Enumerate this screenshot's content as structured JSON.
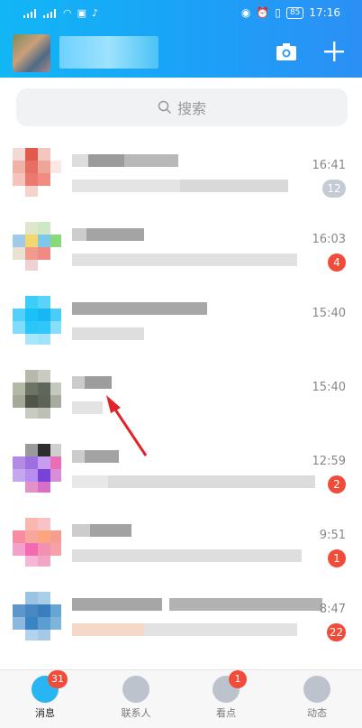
{
  "status_bar": {
    "time": "17:16",
    "battery": "85"
  },
  "search": {
    "placeholder": "搜索"
  },
  "conversations": [
    {
      "time": "16:41",
      "badge": "12",
      "badge_style": "muted"
    },
    {
      "time": "16:03",
      "badge": "4",
      "badge_style": "unread"
    },
    {
      "time": "15:40",
      "badge": "",
      "badge_style": ""
    },
    {
      "time": "15:40",
      "badge": "",
      "badge_style": ""
    },
    {
      "time": "12:59",
      "badge": "2",
      "badge_style": "unread"
    },
    {
      "time": "9:51",
      "badge": "1",
      "badge_style": "unread"
    },
    {
      "time": "8:47",
      "badge": "22",
      "badge_style": "unread"
    }
  ],
  "tabs": [
    {
      "label": "消息",
      "badge": "31",
      "icon": "chat-bubble-icon",
      "active": true
    },
    {
      "label": "联系人",
      "badge": "",
      "icon": "contacts-icon",
      "active": false
    },
    {
      "label": "看点",
      "badge": "1",
      "icon": "eye-icon",
      "active": false
    },
    {
      "label": "动态",
      "badge": "",
      "icon": "planet-icon",
      "active": false
    }
  ],
  "colors": {
    "header_start": "#12b6f5",
    "header_end": "#2c8ff5",
    "unread_badge": "#f04c39",
    "muted_badge": "#c4cbd4",
    "annotation_arrow": "#e0242a"
  }
}
